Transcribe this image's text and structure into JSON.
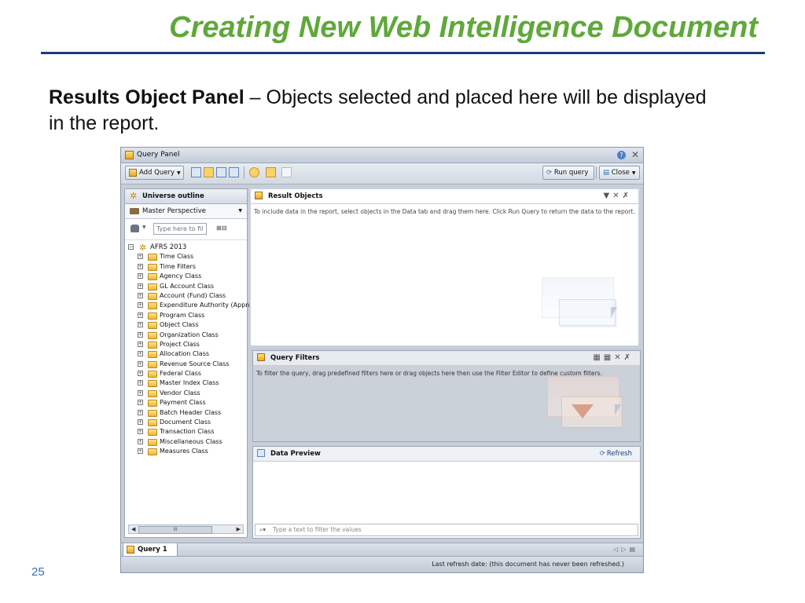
{
  "slide": {
    "title": "Creating New Web Intelligence Document",
    "intro_bold": "Results Object Panel",
    "intro_rest": " – Objects selected and placed here will be displayed in the report.",
    "page_number": "25"
  },
  "window": {
    "title": "Query Panel",
    "toolbar": {
      "add_query": "Add Query",
      "run_query": "Run query",
      "close": "Close"
    }
  },
  "left_panel": {
    "header": "Universe outline",
    "perspective": "Master Perspective",
    "filter_placeholder": "Type here to filt",
    "universe": "AFRS 2013",
    "items": [
      "Time Class",
      "Time Filters",
      "Agency Class",
      "GL Account Class",
      "Account (Fund) Class",
      "Expenditure Authority (Appn)",
      "Program Class",
      "Object Class",
      "Organization Class",
      "Project Class",
      "Allocation Class",
      "Revenue Source Class",
      "Federal Class",
      "Master Index Class",
      "Vendor Class",
      "Payment Class",
      "Batch Header Class",
      "Document Class",
      "Transaction Class",
      "Miscellaneous Class",
      "Measures Class"
    ],
    "scroll_thumb": "III"
  },
  "result_objects": {
    "title": "Result Objects",
    "description": "To include data in the report, select objects in the Data tab and drag them here. Click Run Query to return the data to the report."
  },
  "query_filters": {
    "title": "Query Filters",
    "description": "To filter the query, drag predefined filters here or drag objects here then use the Filter Editor to define custom filters."
  },
  "data_preview": {
    "title": "Data Preview",
    "refresh": "Refresh",
    "search_placeholder": "Type a text to filter the values"
  },
  "tabs": {
    "query1": "Query 1"
  },
  "status": {
    "text": "Last refresh date: (this document has never been refreshed.)"
  }
}
